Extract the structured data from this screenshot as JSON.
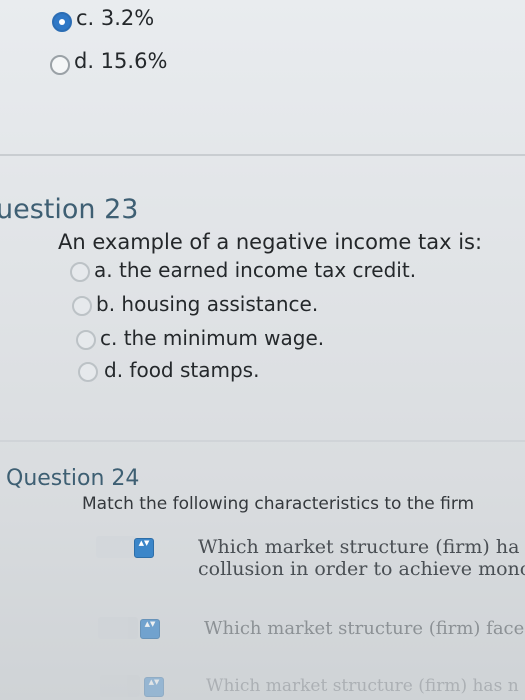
{
  "question22": {
    "options": [
      {
        "label": "c. 3.2%",
        "selected": true
      },
      {
        "label": "d. 15.6%",
        "selected": false
      }
    ]
  },
  "question23": {
    "title": "uestion 23",
    "prompt": "An example of a negative income tax is:",
    "options": [
      {
        "label": "a. the earned income tax credit."
      },
      {
        "label": "b. housing assistance."
      },
      {
        "label": "c. the minimum wage."
      },
      {
        "label": "d. food stamps."
      }
    ]
  },
  "question24": {
    "title": "Question 24",
    "prompt": "Match the following characteristics to the firm",
    "items": [
      {
        "line1": "Which market structure (firm) ha",
        "line2": "collusion in order to achieve mono"
      },
      {
        "line1": "Which market structure (firm) face",
        "line2": ""
      },
      {
        "line1": "Which market structure (firm) has n",
        "line2": ""
      }
    ]
  },
  "colors": {
    "accent": "#2f78c6",
    "title": "#3e5f73",
    "select_button": "#3b86c9"
  }
}
